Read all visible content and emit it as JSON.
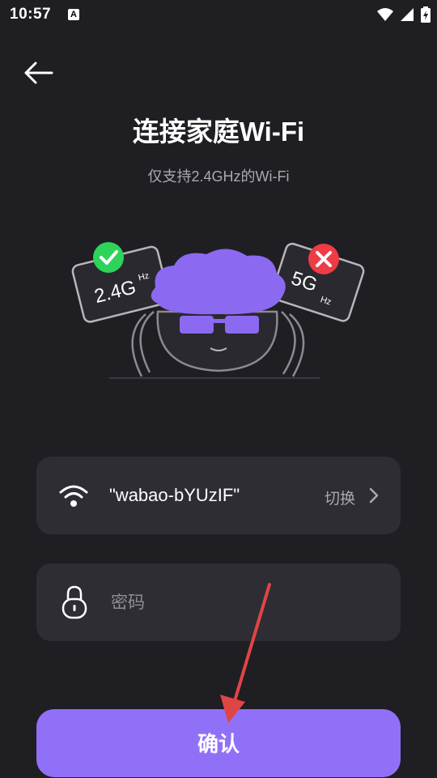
{
  "status_bar": {
    "time": "10:57",
    "notification_badge": "A"
  },
  "header": {
    "back_icon": "arrow-left-icon"
  },
  "page": {
    "title": "连接家庭Wi-Fi",
    "subtitle": "仅支持2.4GHz的Wi-Fi"
  },
  "illustration": {
    "left_badge": "2.4G",
    "left_unit": "Hz",
    "right_badge": "5G",
    "right_unit": "Hz"
  },
  "wifi": {
    "ssid": "\"wabao-bYUzIF\"",
    "switch_label": "切换",
    "icon": "wifi-icon"
  },
  "password": {
    "placeholder": "密码",
    "value": "",
    "icon": "lock-icon"
  },
  "confirm_label": "确认",
  "colors": {
    "background": "#1f1e23",
    "card": "#2e2d34",
    "accent": "#9170f8",
    "annotation_arrow": "#e04545"
  }
}
